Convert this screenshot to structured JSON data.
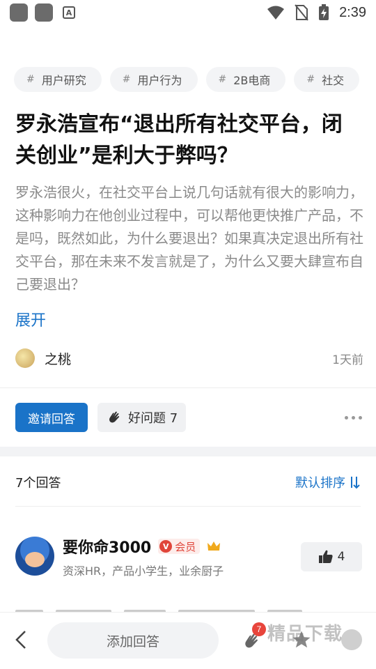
{
  "status_bar": {
    "time": "2:39",
    "icons": [
      "app-square-icon",
      "app-square-icon",
      "font-a-icon",
      "wifi-icon",
      "no-sim-icon",
      "battery-charging-icon"
    ]
  },
  "tags": [
    {
      "hash": "#",
      "label": "用户研究"
    },
    {
      "hash": "#",
      "label": "用户行为"
    },
    {
      "hash": "#",
      "label": "2B电商"
    },
    {
      "hash": "#",
      "label": "社交"
    }
  ],
  "question": {
    "title": "罗永浩宣布“退出所有社交平台，闭关创业”是利大于弊吗？",
    "description": "罗永浩很火，在社交平台上说几句话就有很大的影响力，这种影响力在他创业过程中，可以帮他更快推广产品，不是吗，既然如此，为什么要退出？如果真决定退出所有社交平台，那在未来不发言就是了，为什么又要大肆宣布自己要退出？",
    "expand_label": "展开",
    "author": "之桃",
    "time_ago": "1天前"
  },
  "actions": {
    "invite_label": "邀请回答",
    "good_question_label": "好问题 7"
  },
  "answers": {
    "count_label": "7个回答",
    "sort_label": "默认排序",
    "first": {
      "name": "要你命3000",
      "vip_label": "会员",
      "bio": "资深HR，产品小学生，业余厨子",
      "likes": "4"
    }
  },
  "bottom_bar": {
    "add_answer_label": "添加回答",
    "clap_badge": "7",
    "watermark": "精品下载"
  },
  "colors": {
    "accent": "#1a73c8",
    "vip_red": "#e0453a",
    "badge_red": "#e8453c"
  }
}
